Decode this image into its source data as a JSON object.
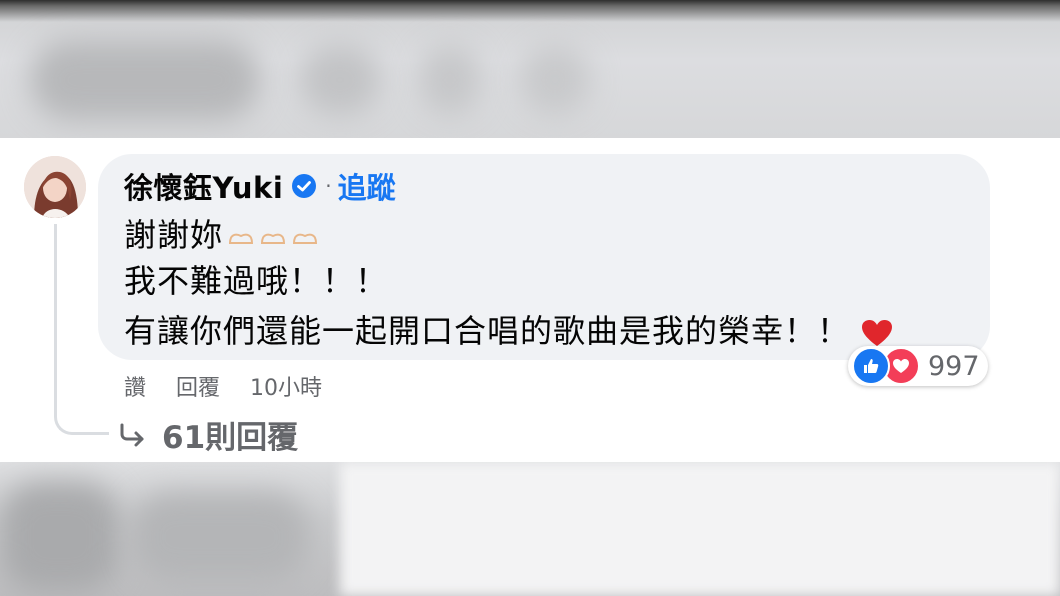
{
  "comment": {
    "author": "徐懷鈺Yuki",
    "verified_icon": "verified-badge-icon",
    "separator": "·",
    "follow_label": "追蹤",
    "lines": [
      "謝謝妳",
      "我不難過哦！！！",
      "有讓你們還能一起開口合唱的歌曲是我的榮幸！！"
    ],
    "reaction_count": "997",
    "actions": {
      "like": "讚",
      "reply": "回覆",
      "time": "10小時"
    },
    "replies_label": "61則回覆"
  },
  "colors": {
    "bubble": "#f0f2f5",
    "text": "#050505",
    "secondary": "#65676b",
    "link": "#1877f2",
    "love": "#f33e58"
  }
}
